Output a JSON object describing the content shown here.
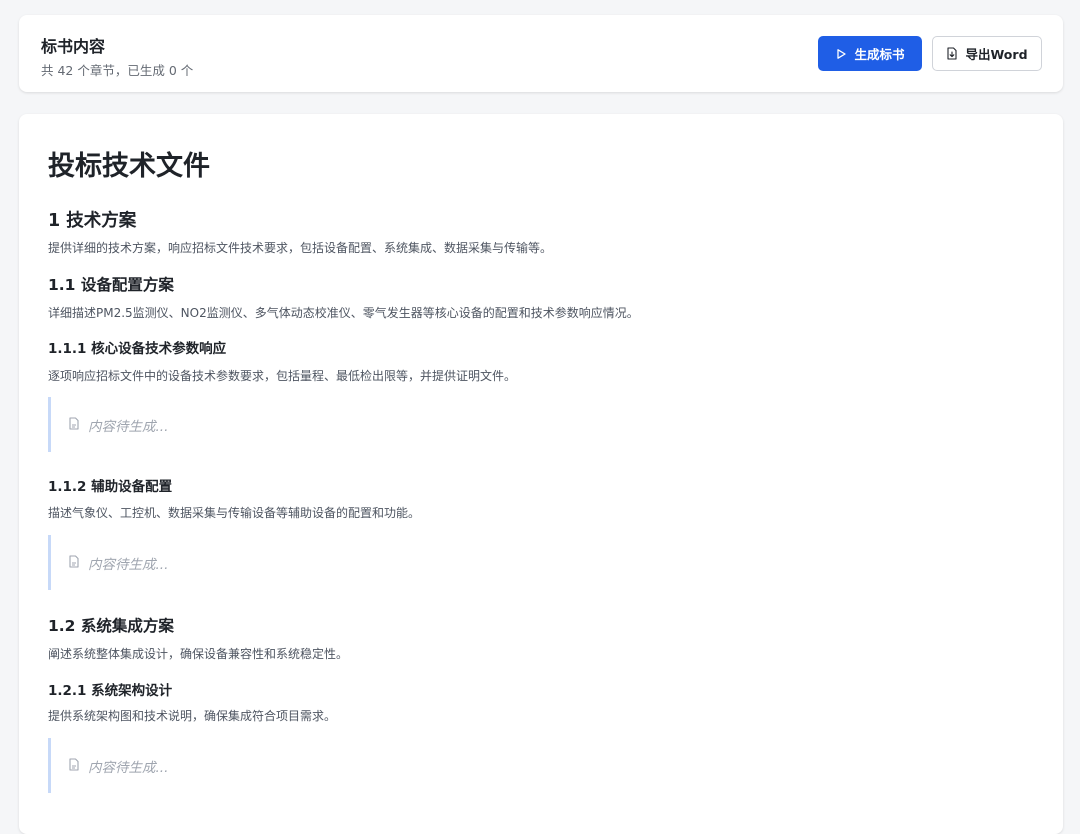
{
  "header": {
    "title": "标书内容",
    "subtitle": "共 42 个章节，已生成 0 个",
    "generate_button": "生成标书",
    "export_button": "导出Word"
  },
  "document": {
    "title": "投标技术文件",
    "placeholder_text": "内容待生成...",
    "sections": [
      {
        "number_title": "1 技术方案",
        "desc": "提供详细的技术方案，响应招标文件技术要求，包括设备配置、系统集成、数据采集与传输等。"
      },
      {
        "number_title": "1.1 设备配置方案",
        "desc": "详细描述PM2.5监测仪、NO2监测仪、多气体动态校准仪、零气发生器等核心设备的配置和技术参数响应情况。"
      },
      {
        "number_title": "1.1.1 核心设备技术参数响应",
        "desc": "逐项响应招标文件中的设备技术参数要求，包括量程、最低检出限等，并提供证明文件。"
      },
      {
        "number_title": "1.1.2 辅助设备配置",
        "desc": "描述气象仪、工控机、数据采集与传输设备等辅助设备的配置和功能。"
      },
      {
        "number_title": "1.2 系统集成方案",
        "desc": "阐述系统整体集成设计，确保设备兼容性和系统稳定性。"
      },
      {
        "number_title": "1.2.1 系统架构设计",
        "desc": "提供系统架构图和技术说明，确保集成符合项目需求。"
      }
    ]
  },
  "colors": {
    "primary": "#1f5ee6",
    "placeholder_border": "#c7d9f8",
    "background": "#f5f6f8"
  },
  "icons": {
    "generate": "play-icon",
    "export": "file-download-icon",
    "placeholder": "file-icon"
  }
}
